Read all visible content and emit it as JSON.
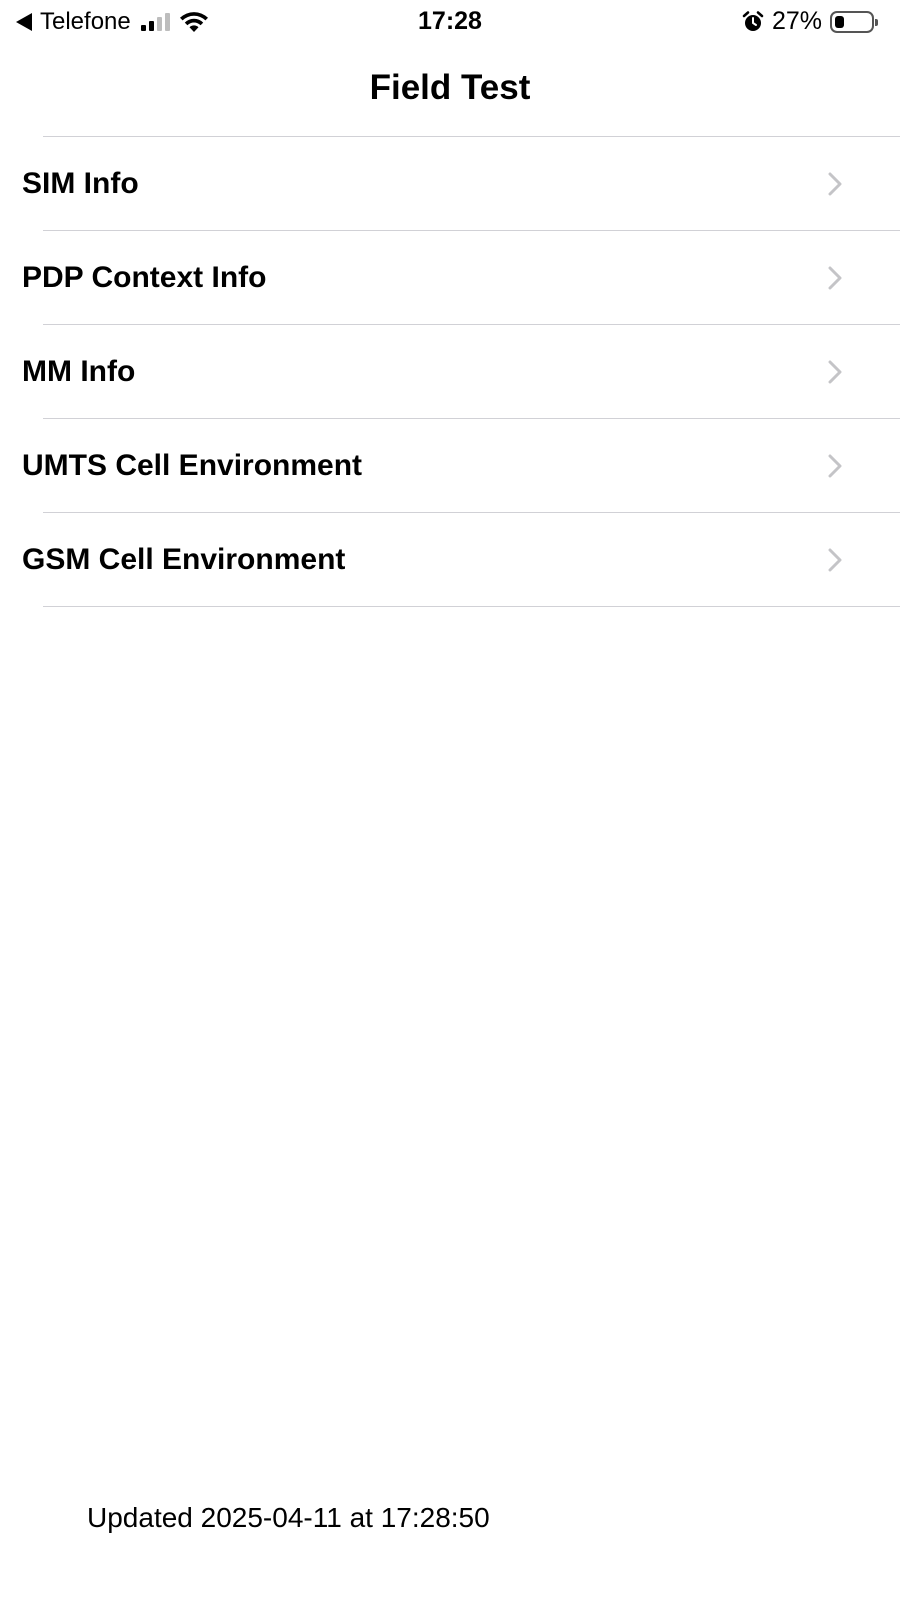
{
  "status_bar": {
    "back_label": "Telefone",
    "time": "17:28",
    "battery_percent_text": "27%",
    "battery_level": 0.27,
    "signal_bars_active": 2,
    "signal_bars_total": 4,
    "icons": [
      "back-arrow-icon",
      "signal-icon",
      "wifi-icon",
      "alarm-icon",
      "battery-icon"
    ]
  },
  "nav": {
    "title": "Field Test"
  },
  "menu": {
    "items": [
      {
        "label": "SIM Info"
      },
      {
        "label": "PDP Context Info"
      },
      {
        "label": "MM Info"
      },
      {
        "label": "UMTS Cell Environment"
      },
      {
        "label": "GSM Cell Environment"
      }
    ]
  },
  "footer": {
    "updated_text": "Updated 2025-04-11 at 17:28:50"
  },
  "colors": {
    "separator": "#d1d1d6",
    "chevron": "#c4c4c7",
    "signal_active": "#000000",
    "signal_inactive": "#bdbdbd"
  }
}
